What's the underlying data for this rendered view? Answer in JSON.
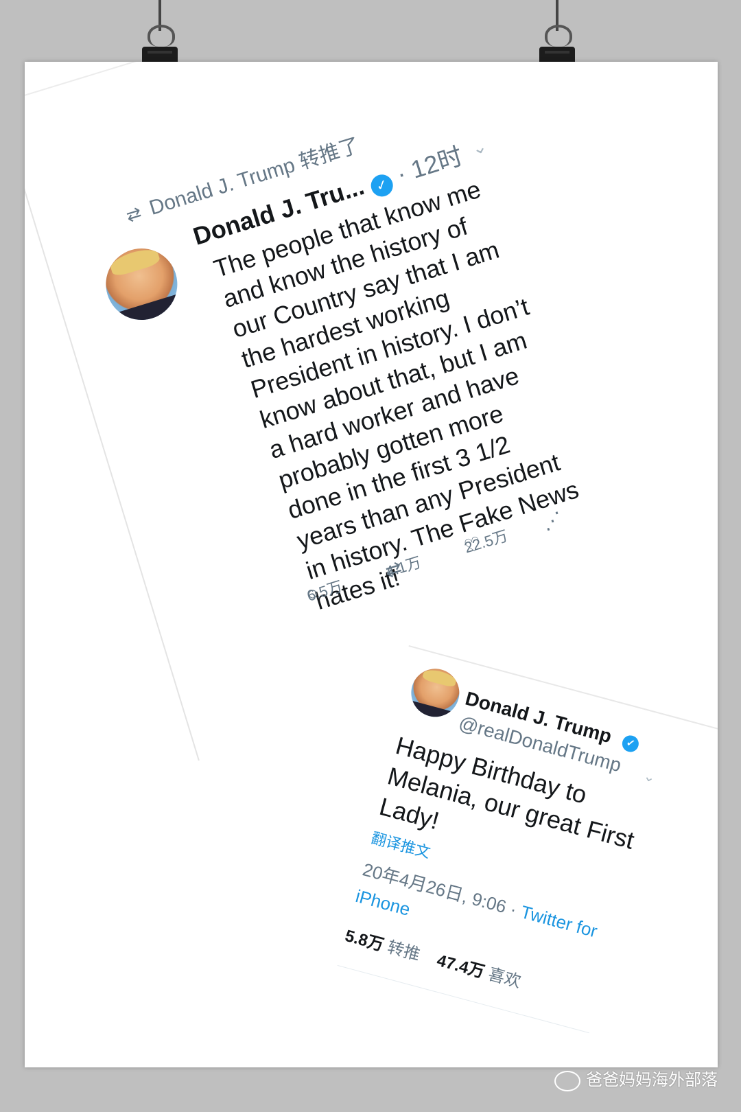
{
  "tweet1": {
    "retweet_line": "Donald J. Trump 转推了",
    "name": "Donald J. Tru...",
    "time": "· 12时",
    "text": "The people that know me and know the history of our Country say that I am the hardest working President in history. I don’t know about that, but I am a hard worker and have probably gotten more done in the first 3 1/2 years than any President in history. The Fake News hates it!",
    "replies": "6.5万",
    "retweets": "4.1万",
    "likes": "22.5万",
    "icons": {
      "retweet": "retweet-icon",
      "verified": "verified-badge-icon",
      "reply": "reply-icon",
      "like": "heart-icon",
      "share": "share-icon",
      "chevron": "chevron-down-icon"
    }
  },
  "tweet2": {
    "name": "Donald J. Trump",
    "handle": "@realDonaldTrump",
    "text": "Happy Birthday to Melania, our great First Lady!",
    "translate": "翻译推文",
    "date": "20年4月26日, 9:06 · ",
    "source": "Twitter for iPhone",
    "retweet_count": "5.8万",
    "retweet_label": "转推",
    "like_count": "47.4万",
    "like_label": "喜欢"
  },
  "watermark": "爸爸妈妈海外部落",
  "colors": {
    "twitter_blue": "#1da1f2",
    "text": "#14171a",
    "secondary": "#657786",
    "background": "#bfbfbf",
    "paper": "#ffffff"
  }
}
